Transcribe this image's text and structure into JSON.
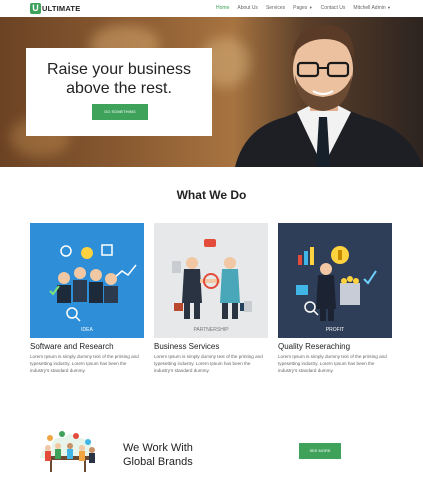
{
  "brand": {
    "mark": "U",
    "name": "ULTIMATE"
  },
  "nav": {
    "items": [
      {
        "label": "Home",
        "active": true
      },
      {
        "label": "About Us",
        "active": false
      },
      {
        "label": "Services",
        "active": false
      },
      {
        "label": "Pages",
        "active": false,
        "dropdown": true
      },
      {
        "label": "Contact Us",
        "active": false
      },
      {
        "label": "Mitchell Admin",
        "active": false,
        "dropdown": true
      }
    ],
    "caret_icon": "caret-down-icon"
  },
  "hero": {
    "title_line1": "Raise your business",
    "title_line2": "above the rest.",
    "button_label": "DO SOMETHING"
  },
  "section": {
    "title": "What We Do"
  },
  "cards": [
    {
      "caption": "IDEA",
      "title": "Software and Research",
      "text": "Lorem Ipsum is simply dummy text of the printing and typesetting industry. Lorem Ipsum has been the industry's standard dummy.",
      "bg": "#2e8fd8"
    },
    {
      "caption": "PARTNERSHIP",
      "title": "Business Services",
      "text": "Lorem Ipsum is simply dummy text of the printing and typesetting industry. Lorem Ipsum has been the industry's standard dummy.",
      "bg": "#e6e8ea"
    },
    {
      "caption": "PROFIT",
      "title": "Quality Reseraching",
      "text": "Lorem Ipsum is simply dummy text of the printing and typesetting industry. Lorem Ipsum has been the industry's standard dummy.",
      "bg": "#2f3e58"
    }
  ],
  "brands": {
    "title_line1": "We Work With",
    "title_line2": "Global Brands",
    "button_label": "SEE MORE"
  },
  "colors": {
    "accent": "#3ea25a"
  }
}
